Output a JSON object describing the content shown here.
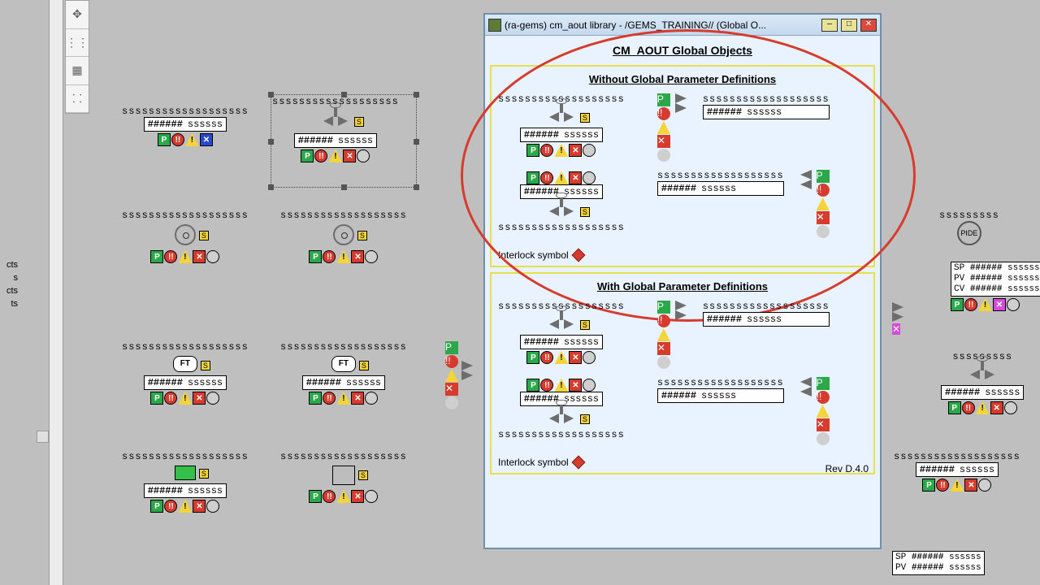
{
  "sidepanel": {
    "lines": "cts\ns\ncts\nts"
  },
  "window": {
    "title": "(ra-gems) cm_aout library - /GEMS_TRAINING// (Global O...",
    "heading": "CM_AOUT Global Objects",
    "section1_title": "Without Global Parameter Definitions",
    "section2_title": "With Global Parameter Definitions",
    "interlock_label": "Interlock symbol",
    "rev": "Rev D.4.0"
  },
  "placeholders": {
    "tag": "sssssssssssssssssss",
    "tag_short": "sssssssss",
    "hash": "######",
    "units": "ssssss",
    "sp": "SP",
    "pv": "PV",
    "cv": "CV",
    "s": "S",
    "p": "P",
    "bang": "!!",
    "warn": "!",
    "x": "✕",
    "ft": "FT",
    "pide": "PIDE"
  }
}
